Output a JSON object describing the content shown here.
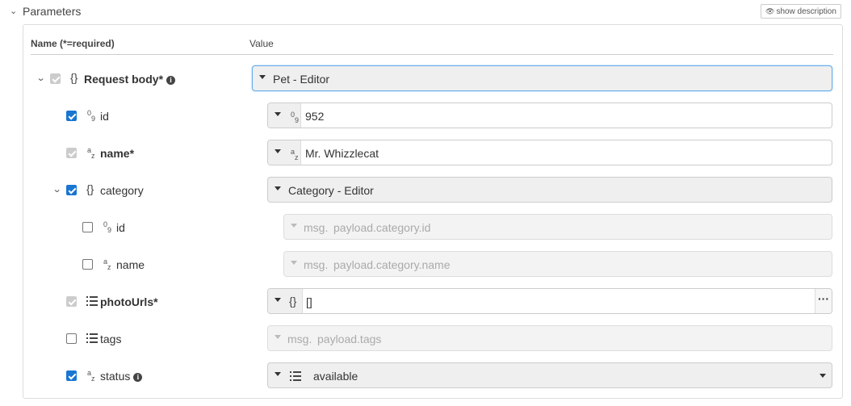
{
  "section": {
    "title": "Parameters",
    "show_description": "show description"
  },
  "columns": {
    "name_prefix": "Name ",
    "name_required": "(*=required)",
    "value": "Value"
  },
  "rows": [
    {
      "label": "Request body*",
      "type_icon": "object-icon",
      "checked": true,
      "disabled": true,
      "expanded": true,
      "value_kind": "editor-select",
      "value": "Pet - Editor"
    },
    {
      "label": "id",
      "type_icon": "number-icon",
      "checked": true,
      "disabled": false,
      "value_kind": "typed-input",
      "value": "952",
      "value_type": "number"
    },
    {
      "label": "name*",
      "type_icon": "string-icon",
      "checked": true,
      "disabled": true,
      "value_kind": "typed-input",
      "value": "Mr. Whizzlecat",
      "value_type": "string"
    },
    {
      "label": "category",
      "type_icon": "object-icon",
      "checked": true,
      "disabled": false,
      "expanded": true,
      "value_kind": "editor-select",
      "value": "Category - Editor"
    },
    {
      "label": "id",
      "type_icon": "number-icon",
      "checked": false,
      "disabled": false,
      "value_kind": "msg-input",
      "prefix": "msg.",
      "value": "payload.category.id"
    },
    {
      "label": "name",
      "type_icon": "string-icon",
      "checked": false,
      "disabled": false,
      "value_kind": "msg-input",
      "prefix": "msg.",
      "value": "payload.category.name"
    },
    {
      "label": "photoUrls*",
      "type_icon": "list-icon",
      "checked": true,
      "disabled": true,
      "value_kind": "json-input",
      "value": "[]",
      "more": "···"
    },
    {
      "label": "tags",
      "type_icon": "list-icon",
      "checked": false,
      "disabled": false,
      "value_kind": "msg-input",
      "prefix": "msg.",
      "value": "payload.tags"
    },
    {
      "label": "status",
      "type_icon": "string-icon",
      "checked": true,
      "disabled": false,
      "value_kind": "enum-select",
      "value": "available"
    }
  ],
  "type_glyphs": {
    "num_top": "0",
    "num_bottom": "9",
    "str_top": "a",
    "str_bottom": "z",
    "obj": "{}"
  },
  "info_glyph": "i",
  "colors": {
    "checkbox": "#1976d2",
    "disabled_checkbox": "#cccccc",
    "focus_border": "#66aee9"
  }
}
